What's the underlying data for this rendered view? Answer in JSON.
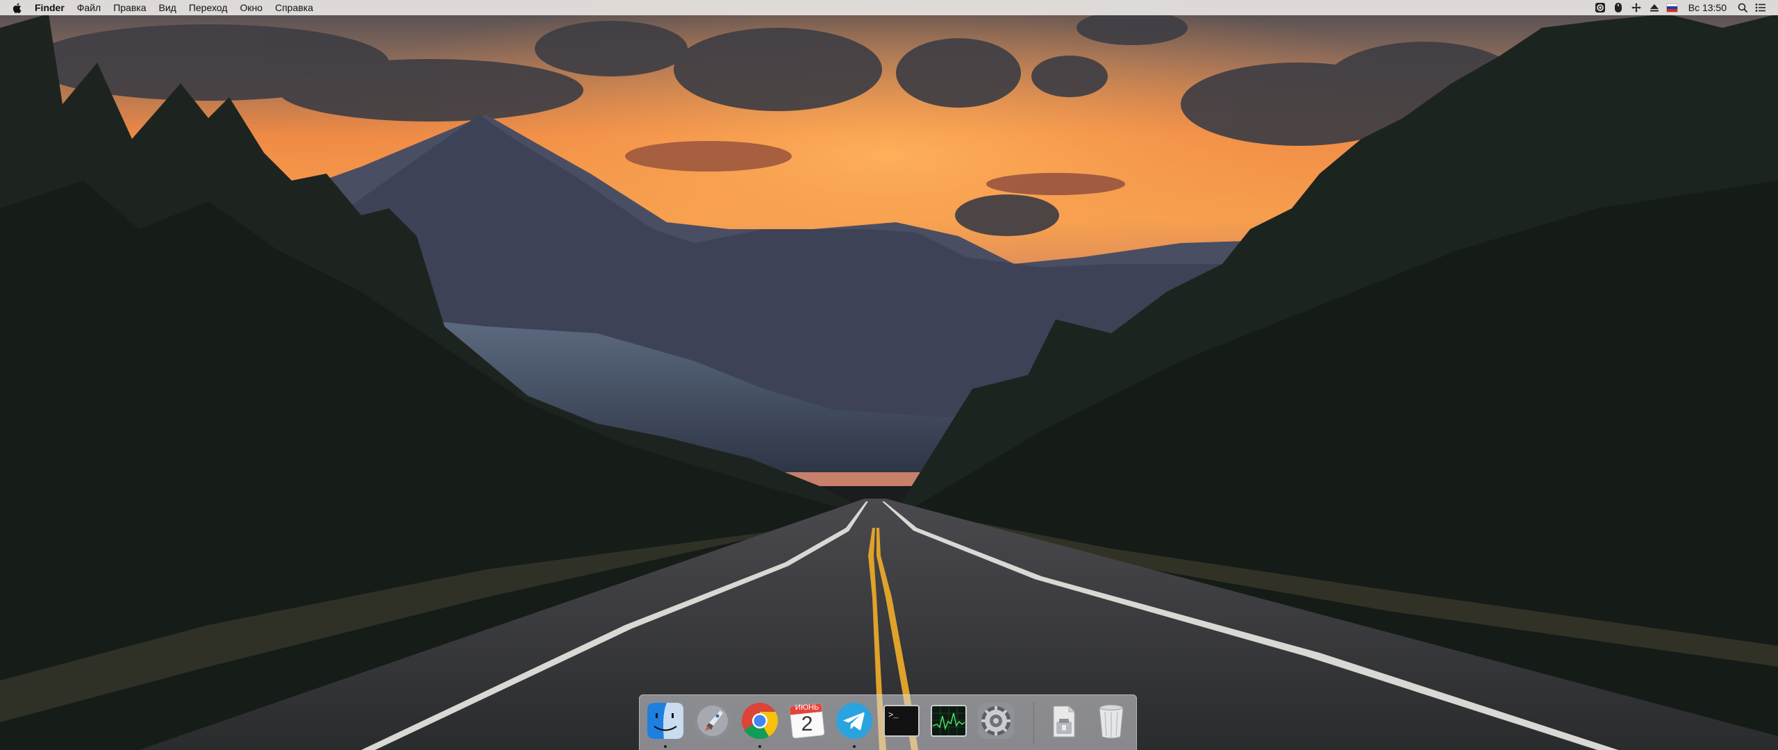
{
  "menubar": {
    "app_name": "Finder",
    "menus": [
      "Файл",
      "Правка",
      "Вид",
      "Переход",
      "Окно",
      "Справка"
    ],
    "status": {
      "clock": "Вс 13:50",
      "input_source": "ru-flag",
      "icons": [
        "screen-record-icon",
        "mouse-icon",
        "cross-arrows-icon",
        "eject-icon",
        "search-icon",
        "list-icon"
      ]
    }
  },
  "dock": {
    "apps": [
      {
        "name": "Finder",
        "icon": "finder-icon",
        "running": true
      },
      {
        "name": "Launchpad",
        "icon": "rocket-icon",
        "running": false
      },
      {
        "name": "Google Chrome",
        "icon": "chrome-icon",
        "running": true
      },
      {
        "name": "Календарь",
        "icon": "calendar-icon",
        "running": false
      },
      {
        "name": "Telegram",
        "icon": "telegram-icon",
        "running": true
      },
      {
        "name": "Terminal",
        "icon": "terminal-icon",
        "running": false
      },
      {
        "name": "Activity Monitor",
        "icon": "activity-monitor-icon",
        "running": false
      },
      {
        "name": "System Preferences",
        "icon": "gear-icon",
        "running": false
      },
      {
        "name": "Downloads",
        "icon": "downloads-stack-icon",
        "running": false
      },
      {
        "name": "Trash",
        "icon": "trash-icon",
        "running": false
      }
    ],
    "calendar": {
      "month": "ИЮНЬ",
      "day": "2"
    },
    "terminal_prompt": ">_"
  },
  "wallpaper": {
    "description_icon": "wallpaper-image",
    "colors": {
      "sky_top": "#4a4a52",
      "sky_glow": "#f79a4a",
      "forest": "#1f2622",
      "road": "#3a3c3e",
      "road_line": "#e0a22a"
    }
  }
}
